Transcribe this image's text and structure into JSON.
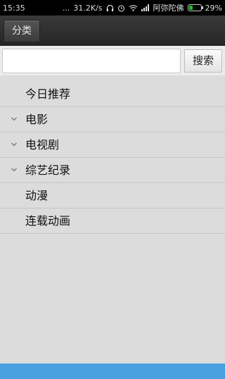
{
  "status_bar": {
    "time": "15:35",
    "dots": "...",
    "speed": "31.2K/s",
    "carrier": "阿弥陀佛",
    "battery_percent": "29%",
    "battery_level": 0.29
  },
  "action_bar": {
    "category_label": "分类"
  },
  "search": {
    "value": "",
    "placeholder": "",
    "button_label": "搜索"
  },
  "menu": {
    "items": [
      {
        "label": "今日推荐",
        "expandable": false
      },
      {
        "label": "电影",
        "expandable": true
      },
      {
        "label": "电视剧",
        "expandable": true
      },
      {
        "label": "综艺纪录",
        "expandable": true
      },
      {
        "label": "动漫",
        "expandable": false
      },
      {
        "label": "连载动画",
        "expandable": false
      }
    ]
  },
  "colors": {
    "background": "#dcdcdc",
    "action_bar": "#2e2e2e",
    "bottom_strip": "#4a9fdf",
    "battery": "#1bc41b"
  }
}
